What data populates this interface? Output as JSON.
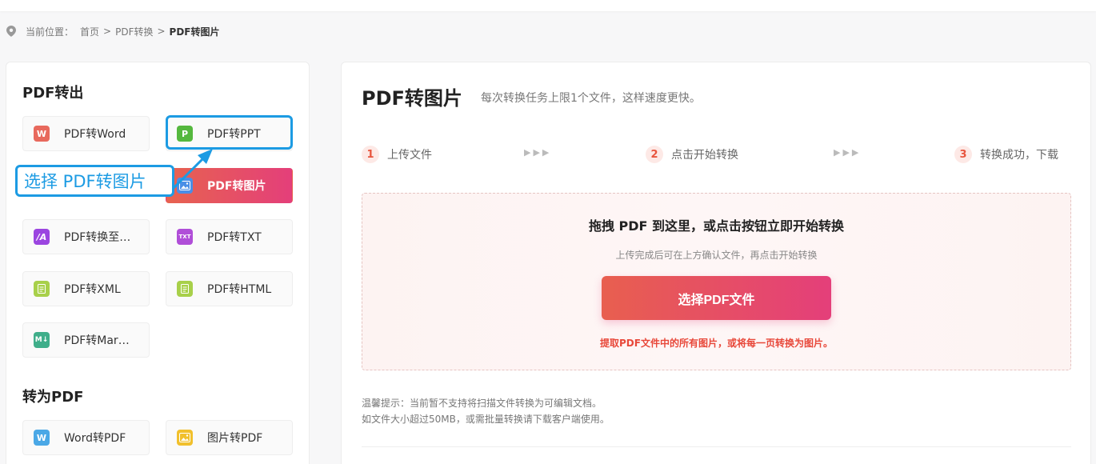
{
  "breadcrumb": {
    "prefix": "当前位置：",
    "items": [
      "首页",
      "PDF转换"
    ],
    "current": "PDF转图片",
    "separator": ">"
  },
  "sidebar": {
    "section_out": "PDF转出",
    "section_in": "转为PDF",
    "out_tools": [
      {
        "label": "PDF转Word",
        "icon": "word-icon",
        "icon_text": "W",
        "color": "#e8695d"
      },
      {
        "label": "PDF转PPT",
        "icon": "ppt-icon",
        "icon_text": "P",
        "color": "#55b83e"
      },
      {
        "label": "PDF转图片",
        "icon": "image-icon",
        "icon_text": "",
        "color": "#4a8ee6"
      },
      {
        "label": "PDF转换至…",
        "icon": "convert-icon",
        "icon_text": "/A",
        "color": "#9b45e0"
      },
      {
        "label": "PDF转TXT",
        "icon": "txt-icon",
        "icon_text": "TXT",
        "color": "#b04ed8"
      },
      {
        "label": "PDF转XML",
        "icon": "xml-icon",
        "icon_text": "",
        "color": "#a8d04a"
      },
      {
        "label": "PDF转HTML",
        "icon": "html-icon",
        "icon_text": "",
        "color": "#a8d04a"
      },
      {
        "label": "PDF转Mar…",
        "icon": "markdown-icon",
        "icon_text": "M↓",
        "color": "#3fae8a"
      }
    ],
    "in_tools": [
      {
        "label": "Word转PDF",
        "icon": "word-icon",
        "icon_text": "W",
        "color": "#4aa8e6"
      },
      {
        "label": "图片转PDF",
        "icon": "image-icon",
        "icon_text": "",
        "color": "#f1c02c"
      }
    ],
    "annotation": "选择 PDF转图片"
  },
  "main": {
    "title": "PDF转图片",
    "subtitle": "每次转换任务上限1个文件，这样速度更快。",
    "steps": [
      {
        "num": "1",
        "label": "上传文件"
      },
      {
        "num": "2",
        "label": "点击开始转换"
      },
      {
        "num": "3",
        "label": "转换成功，下载"
      }
    ],
    "step_arrow": "▶▶▶",
    "dropzone": {
      "title": "拖拽 PDF 到这里，或点击按钮立即开始转换",
      "hint": "上传完成后可在上方确认文件，再点击开始转换",
      "button": "选择PDF文件",
      "note": "提取PDF文件中的所有图片，或将每一页转换为图片。"
    },
    "tips": [
      "温馨提示：当前暂不支持将扫描文件转换为可编辑文档。",
      "如文件大小超过50MB，或需批量转换请下载客户端使用。"
    ]
  },
  "colors": {
    "accent_gradient_start": "#e7634f",
    "accent_gradient_end": "#e43f7a",
    "annotation_blue": "#1c9be3"
  }
}
